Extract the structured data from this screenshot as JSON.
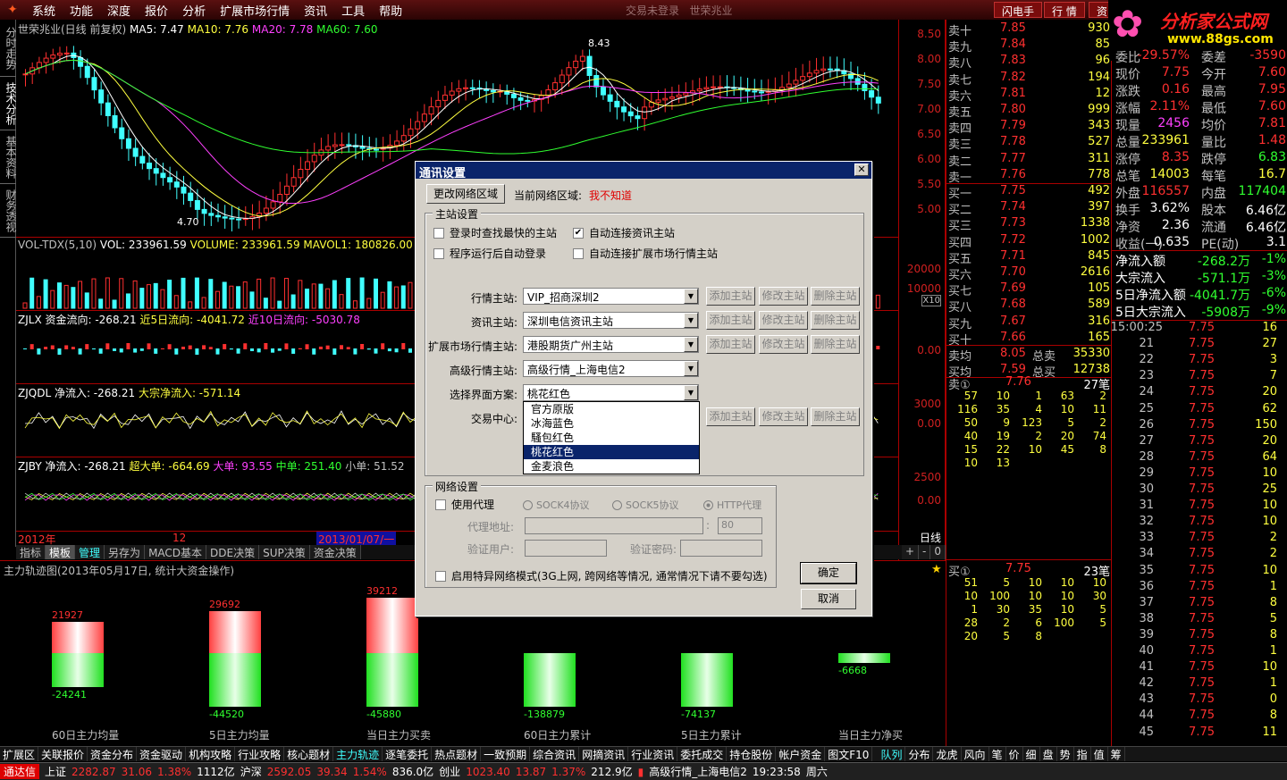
{
  "menu": {
    "items": [
      "系统",
      "功能",
      "深度",
      "报价",
      "分析",
      "扩展市场行情",
      "资讯",
      "工具",
      "帮助"
    ],
    "center_text": "交易未登录",
    "center_stock": "世荣兆业",
    "btn_flash": "闪电手",
    "btn_quote": "行 情",
    "btn_extra": "资"
  },
  "brand": {
    "name": "分析家公式网",
    "url": "www.88gs.com"
  },
  "left_tabs": [
    "分时走势",
    "技术分析",
    "基本资料",
    "财务透视"
  ],
  "main_chart": {
    "title": "世荣兆业(日线 前复权)",
    "ma5": "MA5: 7.47",
    "ma10": "MA10: 7.76",
    "ma20": "MA20: 7.78",
    "ma60": "MA60: 7.60",
    "high_label": "8.43",
    "low_label": "4.70",
    "y_ticks": [
      "8.50",
      "8.00",
      "7.50",
      "7.00",
      "6.50",
      "6.00",
      "5.50",
      "5.00"
    ]
  },
  "vol_panel": {
    "title": "VOL-TDX(5,10)",
    "vol": "VOL: 233961.59",
    "volume": "VOLUME: 233961.59",
    "mavol": "MAVOL1: 180826.00",
    "y_ticks": [
      "20000",
      "10000"
    ],
    "unit": "X10"
  },
  "zjlx": {
    "title": "ZJLX 资金流向: -268.21",
    "f5": "近5日流向: -4041.72",
    "f10": "近10日流向: -5030.78",
    "y0": "0.00"
  },
  "zjqdl": {
    "title": "ZJQDL 净流入: -268.21",
    "big": "大宗净流入: -571.14",
    "y1": "3000",
    "y0": "0.00"
  },
  "zjby": {
    "title": "ZJBY 净流入: -268.21",
    "xl": "超大单: -664.69",
    "l": "大单: 93.55",
    "m": "中单: 251.40",
    "s": "小单: 51.52",
    "y1": "2500",
    "y0": "0.00"
  },
  "datebar": {
    "year": "2012年",
    "m12": "12",
    "sel": "2013/01/07/一",
    "period": "日线"
  },
  "bottom_tabs": [
    "指标",
    "模板",
    "管理",
    "另存为",
    "MACD基本",
    "DDE决策",
    "SUP决策",
    "资金决策"
  ],
  "zoom": {
    "plus": "+",
    "minus": "-",
    "zero": "0"
  },
  "bottom_panel": {
    "title": "主力轨迹图(2013年05月17日, 统计大资金操作)",
    "bars": [
      {
        "label": "60日主力均量",
        "pos": "21927",
        "neg": "-24241",
        "pos_val": 21927,
        "neg_val": 24241
      },
      {
        "label": "5日主力均量",
        "pos": "29692",
        "neg": "-44520",
        "pos_val": 29692,
        "neg_val": 44520
      },
      {
        "label": "当日主力买卖",
        "pos": "39212",
        "neg": "-45880",
        "pos_val": 39212,
        "neg_val": 45880
      },
      {
        "label": "60日主力累计",
        "pos": "",
        "neg": "-138879",
        "pos_val": 0,
        "neg_val": 138879
      },
      {
        "label": "5日主力累计",
        "pos": "",
        "neg": "-74137",
        "pos_val": 0,
        "neg_val": 74137
      },
      {
        "label": "当日主力净买",
        "pos": "",
        "neg": "-6668",
        "pos_val": 0,
        "neg_val": 6668
      }
    ]
  },
  "strip": [
    "扩展区",
    "关联报价",
    "资金分布",
    "资金驱动",
    "机构攻略",
    "行业攻略",
    "核心题材",
    "主力轨迹",
    "逐笔委托",
    "热点题材",
    "一致预期",
    "综合资讯",
    "网摘资讯",
    "行业资讯",
    "委托成交",
    "持仓股份",
    "帐户资金",
    "图文F10",
    "队列",
    "分布",
    "龙虎",
    "风向",
    "笔",
    "价",
    "细",
    "盘",
    "势",
    "指",
    "值",
    "筹"
  ],
  "status": {
    "brand": "通达信",
    "sh": "上证",
    "sh_v": "2282.87",
    "sh_c": "31.06",
    "sh_p": "1.38%",
    "sh_a": "1112亿",
    "sz": "沪深",
    "sz_v": "2592.05",
    "sz_c": "39.34",
    "sz_p": "1.54%",
    "sz_a": "836.0亿",
    "cy": "创业",
    "cy_v": "1023.40",
    "cy_c": "13.87",
    "cy_p": "1.37%",
    "cy_a": "212.9亿",
    "server": "高级行情_上海电信2",
    "time": "19:23:58",
    "day": "周六"
  },
  "order_book": {
    "sell": [
      {
        "l": "卖十",
        "p": "7.85",
        "v": "930"
      },
      {
        "l": "卖九",
        "p": "7.84",
        "v": "85"
      },
      {
        "l": "卖八",
        "p": "7.83",
        "v": "96"
      },
      {
        "l": "卖七",
        "p": "7.82",
        "v": "194"
      },
      {
        "l": "卖六",
        "p": "7.81",
        "v": "12"
      },
      {
        "l": "卖五",
        "p": "7.80",
        "v": "999"
      },
      {
        "l": "卖四",
        "p": "7.79",
        "v": "343"
      },
      {
        "l": "卖三",
        "p": "7.78",
        "v": "527"
      },
      {
        "l": "卖二",
        "p": "7.77",
        "v": "311"
      },
      {
        "l": "卖一",
        "p": "7.76",
        "v": "778"
      }
    ],
    "buy": [
      {
        "l": "买一",
        "p": "7.75",
        "v": "492"
      },
      {
        "l": "买二",
        "p": "7.74",
        "v": "397"
      },
      {
        "l": "买三",
        "p": "7.73",
        "v": "1338"
      },
      {
        "l": "买四",
        "p": "7.72",
        "v": "1002"
      },
      {
        "l": "买五",
        "p": "7.71",
        "v": "845"
      },
      {
        "l": "买六",
        "p": "7.70",
        "v": "2616"
      },
      {
        "l": "买七",
        "p": "7.69",
        "v": "105"
      },
      {
        "l": "买八",
        "p": "7.68",
        "v": "589"
      },
      {
        "l": "买九",
        "p": "7.67",
        "v": "316"
      },
      {
        "l": "买十",
        "p": "7.66",
        "v": "165"
      }
    ],
    "avg_sell_l": "卖均",
    "avg_sell": "8.05",
    "tot_sell_l": "总卖",
    "tot_sell": "35330",
    "avg_buy_l": "买均",
    "avg_buy": "7.59",
    "tot_buy_l": "总买",
    "tot_buy": "12738",
    "sell1_hdr": "卖①",
    "sell1_price": "7.76",
    "sell1_count": "27笔",
    "sell1_queue": [
      [
        "57",
        "10",
        "1",
        "63",
        "2"
      ],
      [
        "116",
        "35",
        "4",
        "10",
        "11"
      ],
      [
        "50",
        "9",
        "123",
        "5",
        "2"
      ],
      [
        "40",
        "19",
        "2",
        "20",
        "74"
      ],
      [
        "15",
        "22",
        "10",
        "45",
        "8"
      ],
      [
        "10",
        "13",
        "",
        "",
        ""
      ]
    ],
    "buy1_hdr": "买①",
    "buy1_price": "7.75",
    "buy1_count": "23笔",
    "buy1_queue": [
      [
        "51",
        "5",
        "10",
        "10",
        "10"
      ],
      [
        "10",
        "100",
        "10",
        "10",
        "30"
      ],
      [
        "1",
        "30",
        "35",
        "10",
        "5"
      ],
      [
        "28",
        "2",
        "6",
        "100",
        "5"
      ],
      [
        "20",
        "5",
        "8",
        "",
        ""
      ]
    ]
  },
  "stock_info": [
    {
      "l1": "委比",
      "v1": "-29.57%",
      "l2": "委差",
      "v2": "-3590"
    },
    {
      "l1": "现价",
      "v1": "7.75",
      "l2": "今开",
      "v2": "7.60"
    },
    {
      "l1": "涨跌",
      "v1": "0.16",
      "l2": "最高",
      "v2": "7.95"
    },
    {
      "l1": "涨幅",
      "v1": "2.11%",
      "l2": "最低",
      "v2": "7.60"
    },
    {
      "l1": "现量",
      "v1": "2456",
      "l2": "均价",
      "v2": "7.81"
    },
    {
      "l1": "总量",
      "v1": "233961",
      "l2": "量比",
      "v2": "1.48"
    },
    {
      "l1": "涨停",
      "v1": "8.35",
      "l2": "跌停",
      "v2": "6.83"
    },
    {
      "l1": "总笔",
      "v1": "14003",
      "l2": "每笔",
      "v2": "16.7"
    },
    {
      "l1": "外盘",
      "v1": "116557",
      "l2": "内盘",
      "v2": "117404"
    },
    {
      "l1": "换手",
      "v1": "3.62%",
      "l2": "股本",
      "v2": "6.46亿"
    },
    {
      "l1": "净资",
      "v1": "2.36",
      "l2": "流通",
      "v2": "6.46亿"
    },
    {
      "l1": "收益(一)",
      "v1": "0.635",
      "l2": "PE(动)",
      "v2": "3.1"
    }
  ],
  "flow_info": [
    {
      "l": "净流入额",
      "v": "-268.2万",
      "p": "-1%"
    },
    {
      "l": "大宗流入",
      "v": "-571.1万",
      "p": "-3%"
    },
    {
      "l": "5日净流入额",
      "v": "-4041.7万",
      "p": "-6%"
    },
    {
      "l": "5日大宗流入",
      "v": "-5908万",
      "p": "-9%"
    }
  ],
  "ticks": [
    {
      "t": "15:00:25",
      "p": "7.75",
      "v": "16"
    },
    {
      "t": "21",
      "p": "7.75",
      "v": "27"
    },
    {
      "t": "22",
      "p": "7.75",
      "v": "3"
    },
    {
      "t": "23",
      "p": "7.75",
      "v": "7"
    },
    {
      "t": "24",
      "p": "7.75",
      "v": "20"
    },
    {
      "t": "25",
      "p": "7.75",
      "v": "62"
    },
    {
      "t": "26",
      "p": "7.75",
      "v": "150"
    },
    {
      "t": "27",
      "p": "7.75",
      "v": "20"
    },
    {
      "t": "28",
      "p": "7.75",
      "v": "64"
    },
    {
      "t": "29",
      "p": "7.75",
      "v": "10"
    },
    {
      "t": "30",
      "p": "7.75",
      "v": "25"
    },
    {
      "t": "31",
      "p": "7.75",
      "v": "10"
    },
    {
      "t": "32",
      "p": "7.75",
      "v": "10"
    },
    {
      "t": "33",
      "p": "7.75",
      "v": "2"
    },
    {
      "t": "34",
      "p": "7.75",
      "v": "2"
    },
    {
      "t": "35",
      "p": "7.75",
      "v": "10"
    },
    {
      "t": "36",
      "p": "7.75",
      "v": "1"
    },
    {
      "t": "37",
      "p": "7.75",
      "v": "8"
    },
    {
      "t": "38",
      "p": "7.75",
      "v": "5"
    },
    {
      "t": "39",
      "p": "7.75",
      "v": "8"
    },
    {
      "t": "40",
      "p": "7.75",
      "v": "1"
    },
    {
      "t": "41",
      "p": "7.75",
      "v": "10"
    },
    {
      "t": "42",
      "p": "7.75",
      "v": "1"
    },
    {
      "t": "43",
      "p": "7.75",
      "v": "0"
    },
    {
      "t": "44",
      "p": "7.75",
      "v": "8"
    },
    {
      "t": "45",
      "p": "7.75",
      "v": "11"
    }
  ],
  "dialog": {
    "title": "通讯设置",
    "change_region_btn": "更改网络区域",
    "cur_region_label": "当前网络区域:",
    "cur_region_value": "我不知道",
    "main_group": "主站设置",
    "chk_fastest": "登录时查找最快的主站",
    "chk_auto_info": "自动连接资讯主站",
    "chk_auto_login": "程序运行后自动登录",
    "chk_auto_ext": "自动连接扩展市场行情主站",
    "rows": [
      {
        "label": "行情主站:",
        "value": "VIP_招商深圳2"
      },
      {
        "label": "资讯主站:",
        "value": "深圳电信资讯主站"
      },
      {
        "label": "扩展市场行情主站:",
        "value": "港股期货广州主站"
      },
      {
        "label": "高级行情主站:",
        "value": "高级行情_上海电信2"
      },
      {
        "label": "选择界面方案:",
        "value": "桃花红色"
      },
      {
        "label": "交易中心:",
        "value": ""
      }
    ],
    "add_btn": "添加主站",
    "edit_btn": "修改主站",
    "del_btn": "删除主站",
    "scheme_options": [
      "官方原版",
      "冰海蓝色",
      "騷包红色",
      "桃花红色",
      "金麦浪色"
    ],
    "net_group": "网络设置",
    "use_proxy": "使用代理",
    "sock4": "SOCK4协议",
    "sock5": "SOCK5协议",
    "http": "HTTP代理",
    "proxy_addr": "代理地址:",
    "proxy_port": "80",
    "verify_user": "验证用户:",
    "verify_pwd": "验证密码:",
    "special_mode": "启用特异网络模式(3G上网, 跨网络等情况, 通常情况下请不要勾选)",
    "ok": "确定",
    "cancel": "取消"
  }
}
